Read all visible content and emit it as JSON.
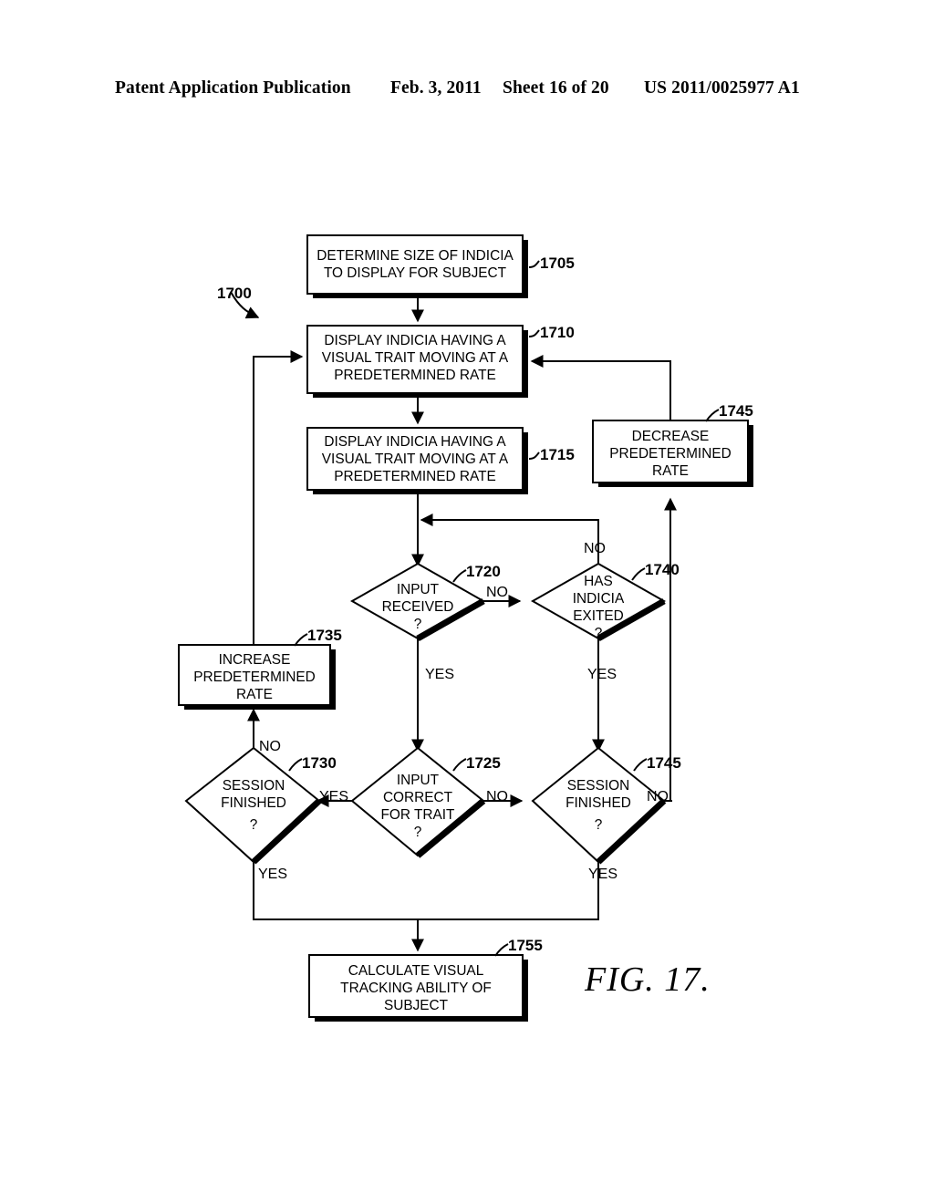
{
  "header": {
    "publication": "Patent Application Publication",
    "date": "Feb. 3, 2011",
    "sheet": "Sheet 16 of 20",
    "number": "US 2011/0025977 A1"
  },
  "figure": {
    "label": "FIG. 17.",
    "diagram_ref": "1700"
  },
  "nodes": [
    {
      "id": "n1705",
      "ref": "1705",
      "type": "process",
      "lines": [
        "DETERMINE SIZE OF INDICIA",
        "TO DISPLAY FOR SUBJECT"
      ]
    },
    {
      "id": "n1710",
      "ref": "1710",
      "type": "process",
      "lines": [
        "DISPLAY INDICIA HAVING A",
        "VISUAL TRAIT MOVING AT A",
        "PREDETERMINED RATE"
      ]
    },
    {
      "id": "n1715",
      "ref": "1715",
      "type": "process",
      "lines": [
        "DISPLAY INDICIA HAVING A",
        "VISUAL TRAIT MOVING AT A",
        "PREDETERMINED RATE"
      ]
    },
    {
      "id": "n1745box",
      "ref": "1745",
      "type": "process",
      "lines": [
        "DECREASE",
        "PREDETERMINED",
        "RATE"
      ]
    },
    {
      "id": "n1735",
      "ref": "1735",
      "type": "process",
      "lines": [
        "INCREASE",
        "PREDETERMINED",
        "RATE"
      ]
    },
    {
      "id": "n1755",
      "ref": "1755",
      "type": "process",
      "lines": [
        "CALCULATE VISUAL",
        "TRACKING ABILITY OF",
        "SUBJECT"
      ]
    },
    {
      "id": "n1720",
      "ref": "1720",
      "type": "decision",
      "lines": [
        "INPUT",
        "RECEIVED",
        "?"
      ]
    },
    {
      "id": "n1740",
      "ref": "1740",
      "type": "decision",
      "lines": [
        "HAS",
        "INDICIA",
        "EXITED",
        "?"
      ]
    },
    {
      "id": "n1730",
      "ref": "1730",
      "type": "decision",
      "lines": [
        "SESSION",
        "FINISHED",
        "?"
      ]
    },
    {
      "id": "n1725",
      "ref": "1725",
      "type": "decision",
      "lines": [
        "INPUT",
        "CORRECT",
        "FOR TRAIT",
        "?"
      ]
    },
    {
      "id": "n1745dia",
      "ref": "1745",
      "type": "decision",
      "lines": [
        "SESSION",
        "FINISHED",
        "?"
      ]
    }
  ],
  "edge_labels": {
    "e1720_no": "NO",
    "e1720_yes": "YES",
    "e1740_no": "NO",
    "e1740_yes": "YES",
    "e1730_no": "NO",
    "e1730_yes_in": "YES",
    "e1730_yes_down": "YES",
    "e1725_no": "NO",
    "e1745_no": "NO",
    "e1745_yes": "YES"
  },
  "colors": {
    "ink": "#000000",
    "paper": "#ffffff"
  }
}
